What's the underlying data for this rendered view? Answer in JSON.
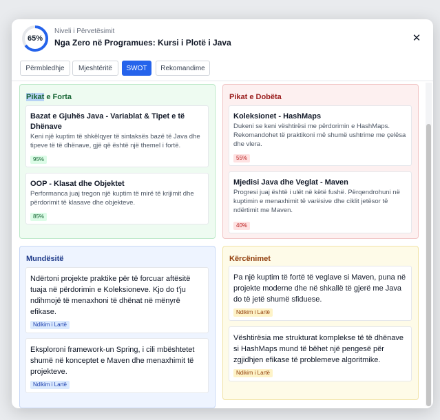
{
  "header": {
    "progress_percent": 65,
    "progress_label": "65%",
    "subtitle": "Niveli i Përvetësimit",
    "title": "Nga Zero në Programues: Kursi i Plotë i Java",
    "close_symbol": "✕"
  },
  "tabs": [
    {
      "label": "Përmbledhje",
      "active": false
    },
    {
      "label": "Mjeshtëritë",
      "active": false
    },
    {
      "label": "SWOT",
      "active": true
    },
    {
      "label": "Rekomandime",
      "active": false
    }
  ],
  "swot": {
    "strengths": {
      "title_highlight": "Pikat",
      "title_rest": " e Forta",
      "items": [
        {
          "title": "Bazat e Gjuhës Java - Variablat & Tipet e të Dhënave",
          "description": "Keni një kuptim të shkëlqyer të sintaksës bazë të Java dhe tipeve të të dhënave, gjë që është një themel i fortë.",
          "score": "95%"
        },
        {
          "title": "OOP - Klasat dhe Objektet",
          "description": "Performanca juaj tregon një kuptim të mirë të krijimit dhe përdorimit të klasave dhe objekteve.",
          "score": "85%"
        }
      ]
    },
    "weaknesses": {
      "title": "Pikat e Dobëta",
      "items": [
        {
          "title": "Koleksionet - HashMaps",
          "description": "Dukeni se keni vështirësi me përdorimin e HashMaps. Rekomandohet të praktikoni më shumë ushtrime me çelësa dhe vlera.",
          "score": "55%"
        },
        {
          "title": "Mjedisi Java dhe Veglat - Maven",
          "description": "Progresi juaj është i ulët në këtë fushë. Përqendrohuni në kuptimin e menaxhimit të varësive dhe ciklit jetësor të ndërtimit me Maven.",
          "score": "40%"
        }
      ]
    },
    "opportunities": {
      "title": "Mundësitë",
      "items": [
        {
          "text": "Ndërtoni projekte praktike për të forcuar aftësitë tuaja në përdorimin e Koleksioneve. Kjo do t'ju ndihmojë të menaxhoni të dhënat në mënyrë efikase.",
          "badge": "Ndikim i Lartë"
        },
        {
          "text": "Eksploroni framework-un Spring, i cili mbështetet shumë në konceptet e Maven dhe menaxhimit të projekteve.",
          "badge": "Ndikim i Lartë"
        }
      ]
    },
    "threats": {
      "title": "Kërcënimet",
      "items": [
        {
          "text": "Pa një kuptim të fortë të veglave si Maven, puna në projekte moderne dhe në shkallë të gjerë me Java do të jetë shumë sfiduese.",
          "badge": "Ndikim i Lartë"
        },
        {
          "text": "Vështirësia me strukturat komplekse të të dhënave si HashMaps mund të bëhet një pengesë për zgjidhjen efikase të problemeve algoritmike.",
          "badge": "Ndikim i Lartë"
        }
      ]
    }
  },
  "colors": {
    "accent": "#2563eb",
    "progress_track": "#e5e7eb"
  }
}
